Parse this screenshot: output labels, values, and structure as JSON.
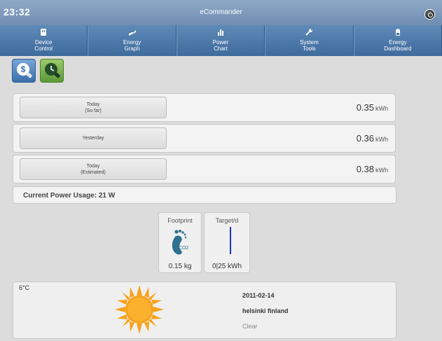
{
  "topbar": {
    "clock": "23:32",
    "title": "eCommander"
  },
  "nav": [
    {
      "line1": "Device",
      "line2": "Control"
    },
    {
      "line1": "Energy",
      "line2": "Graph"
    },
    {
      "line1": "Power",
      "line2": "Chart"
    },
    {
      "line1": "System",
      "line2": "Tools"
    },
    {
      "line1": "Energy",
      "line2": "Dashboard"
    }
  ],
  "energy_rows": [
    {
      "label1": "Today",
      "label2": "(So far)",
      "value": "0.35",
      "unit": "kWh"
    },
    {
      "label1": "Yesterday",
      "label2": "",
      "value": "0.36",
      "unit": "kWh"
    },
    {
      "label1": "Today",
      "label2": "(Estimated)",
      "value": "0.38",
      "unit": "kWh"
    }
  ],
  "power_usage": {
    "label": "Current Power Usage:",
    "value": "21 W"
  },
  "footprint": {
    "title": "Footprint",
    "value": "0.15 kg",
    "co2_text": "CO2"
  },
  "target": {
    "title": "Target/d",
    "value": "0|25 kWh"
  },
  "weather": {
    "temperature": "6°C",
    "date": "2011-02-14",
    "location": "helsinki finland",
    "condition": "Clear"
  },
  "colors": {
    "nav_bg": "#4e79a8",
    "accent_blue": "#1a33c8",
    "sun": "#f7a21b",
    "footprint": "#2f6f8f"
  }
}
